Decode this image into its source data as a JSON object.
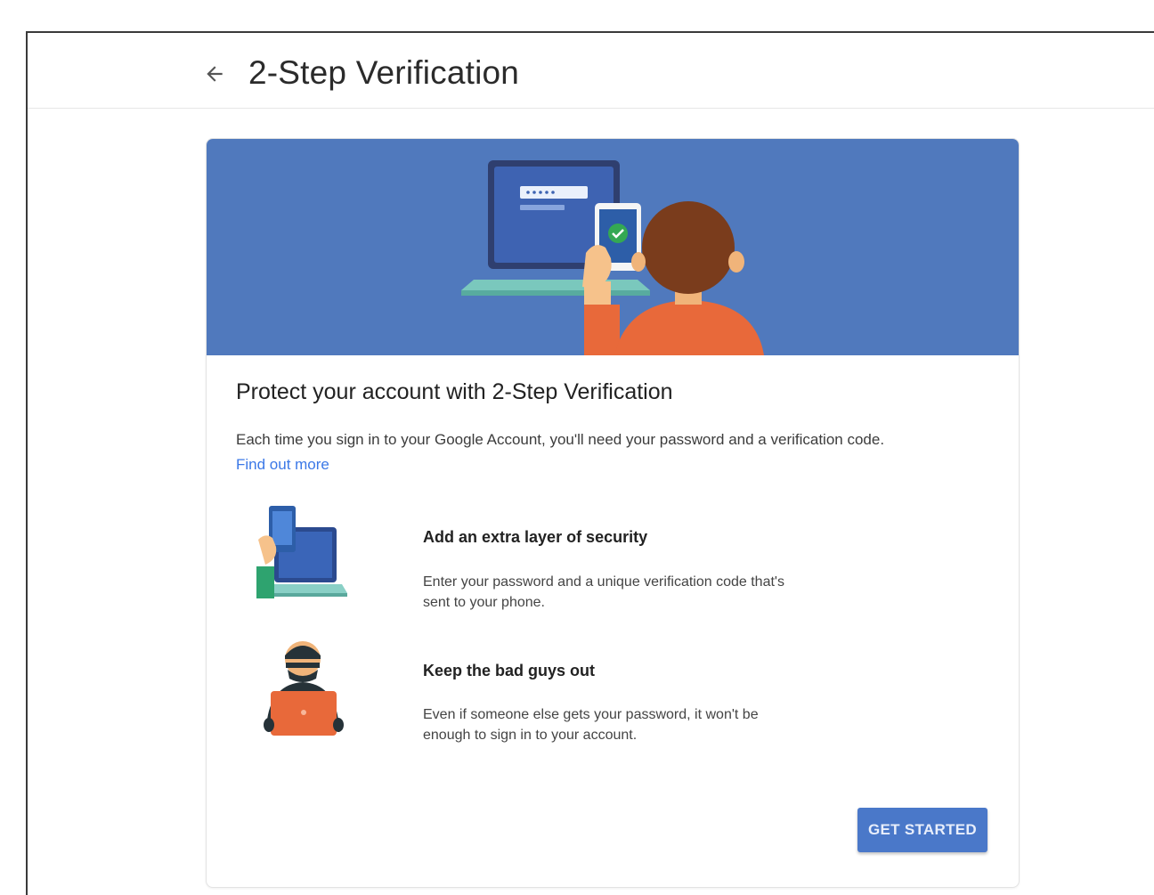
{
  "header": {
    "back_icon": "arrow-back-icon",
    "title": "2-Step Verification"
  },
  "card": {
    "banner_color": "#5079bd",
    "heading": "Protect your account with 2-Step Verification",
    "description": "Each time you sign in to your Google Account, you'll need your password and a verification code.",
    "link_text": "Find out more",
    "link_color": "#3b78e7",
    "features": [
      {
        "icon": "phone-laptop-illustration",
        "title": "Add an extra layer of security",
        "text_line1": "Enter your password and a unique verification code that's",
        "text_line2": "sent to your phone."
      },
      {
        "icon": "hacker-illustration",
        "title": "Keep the bad guys out",
        "text_line1": "Even if someone else gets your password, it won't be",
        "text_line2": "enough to sign in to your account."
      }
    ],
    "button_label": "GET STARTED",
    "button_color": "#4a78c9"
  }
}
